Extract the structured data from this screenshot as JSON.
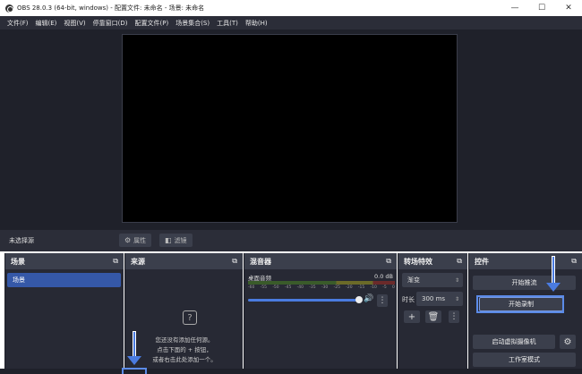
{
  "window": {
    "title": "OBS 28.0.3 (64-bit, windows) - 配置文件: 未命名 - 场景: 未命名",
    "minimize": "—",
    "maximize": "☐",
    "close": "✕"
  },
  "menu": [
    "文件(F)",
    "编辑(E)",
    "视图(V)",
    "停靠窗口(D)",
    "配置文件(P)",
    "场景集合(S)",
    "工具(T)",
    "帮助(H)"
  ],
  "source_bar": {
    "no_source": "未选择源",
    "properties": "属性",
    "filters": "滤镜"
  },
  "scenes": {
    "title": "场景",
    "items": [
      "场景"
    ]
  },
  "sources": {
    "title": "来源",
    "empty_line1": "您还没有添加任何源。",
    "empty_line2": "点击下面的 + 按钮，",
    "empty_line3": "或者右击此处添加一个。"
  },
  "mixer": {
    "title": "混音器",
    "channel": "桌面音频",
    "level": "0.0 dB",
    "ticks": [
      "-60",
      "-55",
      "-50",
      "-45",
      "-40",
      "-35",
      "-30",
      "-25",
      "-20",
      "-15",
      "-10",
      "-5",
      "0"
    ]
  },
  "transitions": {
    "title": "转场特效",
    "type": "渐变",
    "duration_label": "时长",
    "duration_value": "300 ms"
  },
  "controls": {
    "title": "控件",
    "start_stream": "开始推流",
    "start_record": "开始录制",
    "virtual_cam": "启动虚拟摄像机",
    "studio_mode": "工作室模式",
    "settings": "设置"
  },
  "icons": {
    "popout": "popout-icon",
    "help": "help-icon",
    "gear": "gear-icon",
    "plus": "plus-icon",
    "trash": "trash-icon",
    "kebab": "kebab-icon",
    "speaker": "speaker-icon",
    "arrow": "arrow-down-icon"
  },
  "colors": {
    "accent": "#4a7be0",
    "dark_bg": "#272934",
    "panel_head": "#3b3f4c",
    "selected_scene": "#3558a8"
  }
}
